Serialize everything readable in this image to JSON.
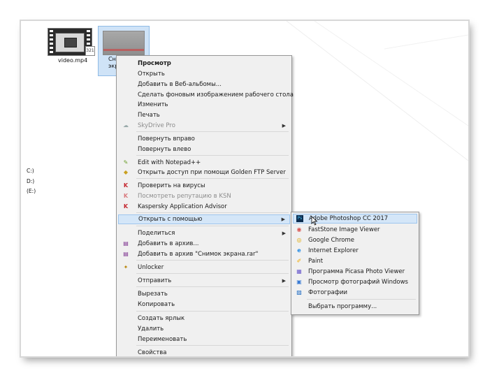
{
  "desktop": {
    "video_label": "video.mp4",
    "video_badge": "321",
    "selected_label_l1": "Сн",
    "selected_label_l2": "экра",
    "drives": [
      "C:)",
      "D:)",
      "(E:)"
    ]
  },
  "context_menu": {
    "items": [
      {
        "label": "Просмотр",
        "bold": true
      },
      {
        "label": "Открыть"
      },
      {
        "label": "Добавить в Веб-альбомы..."
      },
      {
        "label": "Сделать фоновым изображением рабочего стола"
      },
      {
        "label": "Изменить"
      },
      {
        "label": "Печать"
      },
      {
        "label": "SkyDrive Pro",
        "disabled": true,
        "submenu": true,
        "icon": "skydrive-icon"
      },
      {
        "label": "Повернуть вправо"
      },
      {
        "label": "Повернуть влево"
      },
      {
        "label": "Edit with Notepad++",
        "icon": "notepad-plus-icon"
      },
      {
        "label": "Открыть доступ при помощи Golden FTP Server",
        "icon": "ftp-server-icon"
      },
      {
        "label": "Проверить на вирусы",
        "icon": "kaspersky-icon"
      },
      {
        "label": "Посмотреть репутацию в KSN",
        "disabled": true,
        "icon": "kaspersky-icon"
      },
      {
        "label": "Kaspersky Application Advisor",
        "icon": "kaspersky-icon"
      },
      {
        "label": "Открыть с помощью",
        "submenu": true,
        "highlighted": true
      },
      {
        "label": "Поделиться",
        "submenu": true
      },
      {
        "label": "Добавить в архив...",
        "icon": "winrar-icon"
      },
      {
        "label": "Добавить в архив \"Снимок экрана.rar\"",
        "icon": "winrar-icon"
      },
      {
        "label": "Unlocker",
        "icon": "unlocker-icon"
      },
      {
        "label": "Отправить",
        "submenu": true
      },
      {
        "label": "Вырезать"
      },
      {
        "label": "Копировать"
      },
      {
        "label": "Создать ярлык"
      },
      {
        "label": "Удалить"
      },
      {
        "label": "Переименовать"
      },
      {
        "label": "Свойства"
      }
    ]
  },
  "open_with_submenu": {
    "items": [
      {
        "label": "Adobe Photoshop CC 2017",
        "icon": "photoshop-icon",
        "highlighted": true
      },
      {
        "label": "FastStone Image Viewer",
        "icon": "faststone-icon"
      },
      {
        "label": "Google Chrome",
        "icon": "chrome-icon"
      },
      {
        "label": "Internet Explorer",
        "icon": "ie-icon"
      },
      {
        "label": "Paint",
        "icon": "paint-icon"
      },
      {
        "label": "Программа Picasa Photo Viewer",
        "icon": "picasa-icon"
      },
      {
        "label": "Просмотр фотографий Windows",
        "icon": "photo-viewer-icon"
      },
      {
        "label": "Фотографии",
        "icon": "photos-icon"
      },
      {
        "label": "Выбрать программу..."
      }
    ]
  },
  "colors": {
    "menu_bg": "#f0f0f0",
    "highlight": "#d4e6f8",
    "selection": "#cfe3f7"
  }
}
